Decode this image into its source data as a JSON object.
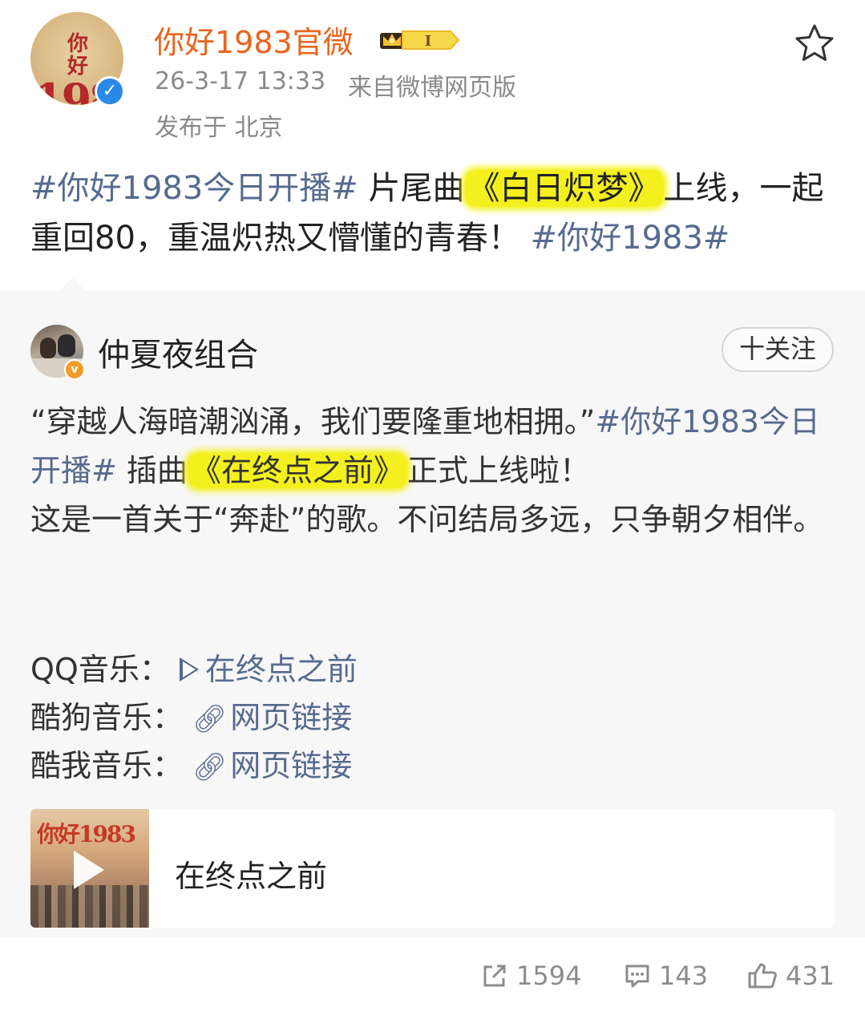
{
  "author": {
    "name": "你好1983官微",
    "level_badge": "I",
    "time": "26-3-17 13:33",
    "source": "来自微博网页版",
    "location": "发布于 北京"
  },
  "avatar_logo": {
    "line1": "你好",
    "line2": "1983"
  },
  "post": {
    "tag1": "#你好1983今日开播#",
    "text1": " 片尾曲",
    "highlight": "《白日炽梦》",
    "text2": "上线，一起重回80，重温炽热又懵懂的青春！",
    "tag2": "#你好1983#"
  },
  "repost": {
    "user_name": "仲夏夜组合",
    "follow_label": "十关注",
    "quote": "“穿越人海暗潮汹涌，我们要隆重地相拥。”",
    "tag": "#你好1983今日开播#",
    "text1": " 插曲",
    "highlight": "《在终点之前》",
    "text2": "正式上线啦！",
    "line3": "这是一首关于“奔赴”的歌。不问结局多远，只争朝夕相伴。",
    "music": [
      {
        "platform": "QQ音乐：",
        "link": "在终点之前",
        "icon": "play-icon"
      },
      {
        "platform": "酷狗音乐：",
        "link": "网页链接",
        "icon": "link-icon"
      },
      {
        "platform": "酷我音乐：",
        "link": "网页链接",
        "icon": "link-icon"
      }
    ],
    "card": {
      "title": "在终点之前",
      "thumb_title": "你好1983"
    }
  },
  "stats": {
    "reposts": "1594",
    "comments": "143",
    "likes": "431"
  },
  "colors": {
    "author_name": "#e8651f",
    "topic_link": "#566b8f",
    "highlight": "#f4f01d",
    "repost_bg": "#f7f7f7",
    "meta": "#8a8a8a"
  }
}
